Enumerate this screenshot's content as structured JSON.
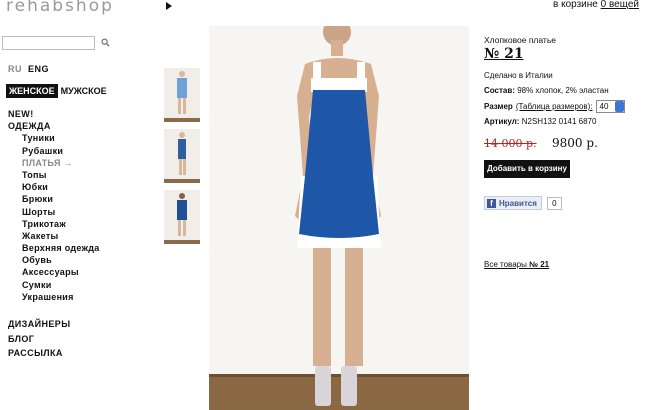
{
  "header": {
    "logo": "rehabshop",
    "cart_prefix": "в корзине",
    "cart_link": "0 вещей"
  },
  "search": {
    "placeholder": "",
    "icon": "search-icon"
  },
  "languages": {
    "ru": "RU",
    "eng": "ENG"
  },
  "gender_tabs": {
    "women": "ЖЕНСКОЕ",
    "men": "МУЖСКОЕ"
  },
  "nav": {
    "new": "NEW!",
    "clothing": "ОДЕЖДА",
    "items": [
      "Туники",
      "Рубашки",
      "ПЛАТЬЯ →",
      "Топы",
      "Юбки",
      "Брюки",
      "Шорты",
      "Трикотаж",
      "Жакеты",
      "Верхняя одежда",
      "Обувь",
      "Аксессуары",
      "Сумки",
      "Украшения"
    ],
    "designers": "ДИЗАЙНЕРЫ",
    "blog": "БЛОГ",
    "newsletter": "РАССЫЛКА"
  },
  "product": {
    "title": "Хлопковое платье",
    "number": "№ 21",
    "made_in": "Сделано в Италии",
    "composition_label": "Состав:",
    "composition": " 98% хлопок, 2% эластан",
    "size_label": "Размер",
    "size_table_link": "(Таблица размеров):",
    "size_value": "40",
    "article_label": "Артикул:",
    "article": " N2SH132 0141 6870",
    "old_price": "14 000 р.",
    "price": "9800 р.",
    "add_to_cart": "Добавить в корзину",
    "like_label": "Нравится",
    "like_count": "0",
    "all_items_prefix": "Все товары ",
    "all_items_num": "№ 21"
  },
  "colors": {
    "dress_blue": "#1f57a8",
    "price_red": "#b3261e",
    "fb_blue": "#3b5998"
  }
}
